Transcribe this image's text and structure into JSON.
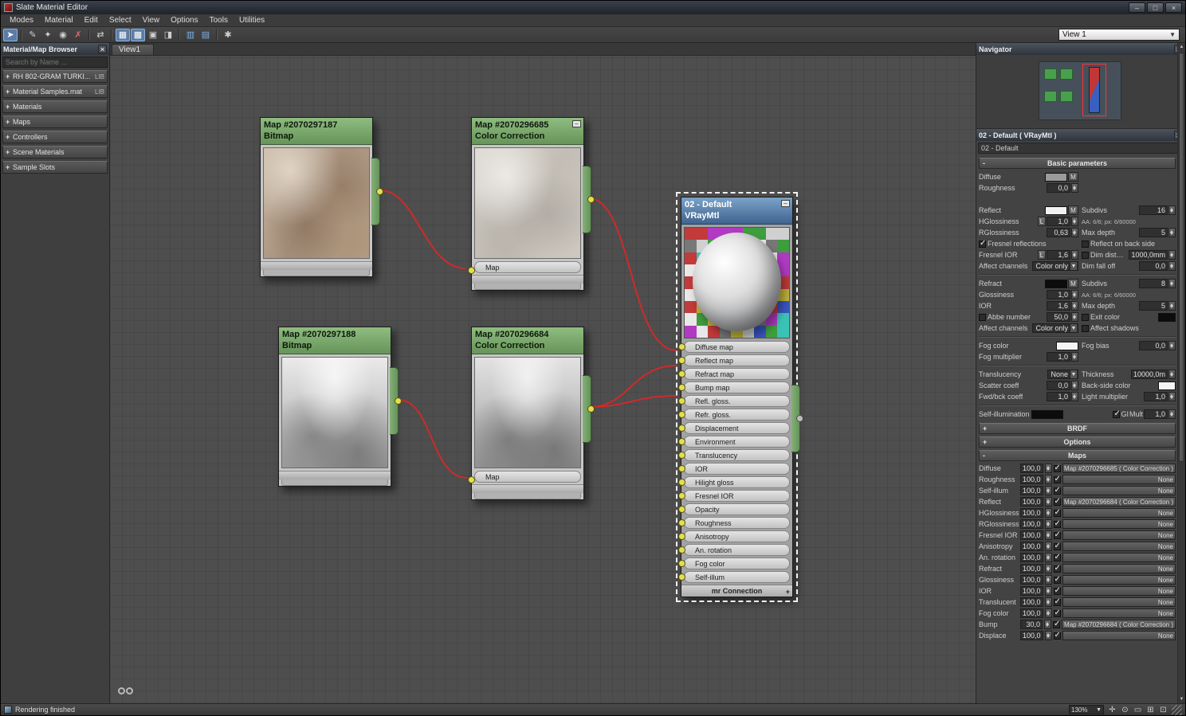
{
  "titlebar": {
    "title": "Slate Material Editor"
  },
  "window_controls": [
    {
      "name": "minimize-button",
      "glyph": "–"
    },
    {
      "name": "maximize-button",
      "glyph": "□"
    },
    {
      "name": "close-button",
      "glyph": "×"
    }
  ],
  "menubar": {
    "items": [
      "Modes",
      "Material",
      "Edit",
      "Select",
      "View",
      "Options",
      "Tools",
      "Utilities"
    ]
  },
  "toolbar": {
    "view_selector": "View 1",
    "icons": [
      {
        "name": "select-tool-icon",
        "glyph": "➤",
        "active": true
      },
      {
        "sep": true
      },
      {
        "name": "pick-material-from-object-icon",
        "glyph": "✎"
      },
      {
        "name": "put-material-to-scene-icon",
        "glyph": "✦"
      },
      {
        "name": "assign-material-to-selection-icon",
        "glyph": "◉"
      },
      {
        "name": "delete-selected-icon",
        "glyph": "✗",
        "red": true
      },
      {
        "sep": true
      },
      {
        "name": "move-children-icon",
        "glyph": "⇄"
      },
      {
        "sep": true
      },
      {
        "name": "show-grid-icon",
        "glyph": "▦",
        "active": true
      },
      {
        "name": "show-background-icon",
        "glyph": "▩",
        "active": true
      },
      {
        "name": "material-id-channel-icon",
        "glyph": "▣"
      },
      {
        "name": "render-preview-icon",
        "glyph": "◨"
      },
      {
        "sep": true
      },
      {
        "name": "layout-all-icon",
        "glyph": "▥",
        "accent": true
      },
      {
        "name": "layout-children-icon",
        "glyph": "▤",
        "accent": true
      },
      {
        "sep": true
      },
      {
        "name": "options-icon",
        "glyph": "✱"
      }
    ]
  },
  "browser": {
    "title": "Material/Map Browser",
    "search_placeholder": "Search by Name ...",
    "sections": [
      {
        "label": "RH 802-GRAM TURKI...",
        "badge": "LIB"
      },
      {
        "label": "Material Samples.mat",
        "badge": "LIB"
      },
      {
        "label": "Materials",
        "badge": ""
      },
      {
        "label": "Maps",
        "badge": ""
      },
      {
        "label": "Controllers",
        "badge": ""
      },
      {
        "label": "Scene Materials",
        "badge": ""
      },
      {
        "label": "Sample Slots",
        "badge": ""
      }
    ]
  },
  "viewtab": {
    "label": "View1"
  },
  "graph": {
    "nodes": {
      "bitmap1": {
        "title": "Map #2070297187",
        "subtitle": "Bitmap"
      },
      "cc1": {
        "title": "Map #2070296685",
        "subtitle": "Color Correction",
        "slot": "Map"
      },
      "bitmap2": {
        "title": "Map #2070297188",
        "subtitle": "Bitmap"
      },
      "cc2": {
        "title": "Map #2070296684",
        "subtitle": "Color Correction",
        "slot": "Map"
      },
      "vray": {
        "title": "02 - Default",
        "subtitle": "VRayMtl",
        "slots": [
          "Diffuse map",
          "Reflect map",
          "Refract map",
          "Bump map",
          "Refl. gloss.",
          "Refr. gloss.",
          "Displacement",
          "Environment",
          "Translucency",
          "IOR",
          "Hilight gloss",
          "Fresnel IOR",
          "Opacity",
          "Roughness",
          "Anisotropy",
          "An. rotation",
          "Fog color",
          "Self-illum"
        ],
        "footer": "mr Connection"
      }
    },
    "wire_color": "#cf2a2a",
    "preview_palette": [
      "#3f9d3f",
      "#c23a3a",
      "#3a55c2",
      "#e8e8e8",
      "#d0d0d0",
      "#b03ac2",
      "#c2b63a",
      "#3ac2b6",
      "#787878"
    ]
  },
  "navigator": {
    "title": "Navigator"
  },
  "inspector": {
    "title": "02 - Default  ( VRayMtl )",
    "name_value": "02 - Default",
    "m": "M",
    "L": "L",
    "basic": {
      "header": "Basic parameters",
      "diffuse": "Diffuse",
      "roughness": "Roughness",
      "roughness_v": "0,0",
      "reflect": "Reflect",
      "hglossiness": "HGlossiness",
      "hglossiness_v": "1,0",
      "rglossiness": "RGlossiness",
      "rglossiness_v": "0,63",
      "fresnel_reflections": "Fresnel reflections",
      "fresnel_ior": "Fresnel IOR",
      "fresnel_ior_v": "1,6",
      "affect_channels": "Affect channels",
      "affect_channels_v": "Color only",
      "subdivs": "Subdivs",
      "subdivs_v": "16",
      "aa": "AA: 6/6; px: 6/60000",
      "max_depth": "Max depth",
      "max_depth_v": "5",
      "reflect_back": "Reflect on back side",
      "dim_distance": "Dim distance",
      "dim_distance_v": "1000,0mm",
      "dim_falloff": "Dim fall off",
      "dim_falloff_v": "0,0"
    },
    "refract": {
      "refract": "Refract",
      "glossiness": "Glossiness",
      "glossiness_v": "1,0",
      "ior": "IOR",
      "ior_v": "1,6",
      "abbe": "Abbe number",
      "abbe_v": "50,0",
      "affect_channels": "Affect channels",
      "affect_channels_v": "Color only",
      "subdivs": "Subdivs",
      "subdivs_v": "8",
      "aa": "AA: 6/6; px: 6/60000",
      "max_depth": "Max depth",
      "max_depth_v": "5",
      "exit_color": "Exit color",
      "affect_shadows": "Affect shadows"
    },
    "fog": {
      "fog_color": "Fog color",
      "fog_multiplier": "Fog multiplier",
      "fog_multiplier_v": "1,0",
      "fog_bias": "Fog bias",
      "fog_bias_v": "0,0"
    },
    "translucency": {
      "translucency": "Translucency",
      "translucency_v": "None",
      "scatter": "Scatter coeff",
      "scatter_v": "0,0",
      "fwdbck": "Fwd/bck coeff",
      "fwdbck_v": "1,0",
      "thickness": "Thickness",
      "thickness_v": "10000,0m",
      "backside": "Back-side color",
      "light_mult": "Light multiplier",
      "light_mult_v": "1,0"
    },
    "selfillum": {
      "label": "Self-illumination",
      "gi": "GI",
      "mult": "Mult",
      "mult_v": "1,0"
    },
    "rollouts": {
      "brdf": "BRDF",
      "options": "Options",
      "maps": "Maps"
    },
    "maps_rows": [
      {
        "label": "Diffuse",
        "amount": "100,0",
        "map": "Map #2070296685  ( Color Correction )"
      },
      {
        "label": "Roughness",
        "amount": "100,0",
        "map": "None"
      },
      {
        "label": "Self-illum",
        "amount": "100,0",
        "map": "None"
      },
      {
        "label": "Reflect",
        "amount": "100,0",
        "map": "Map #2070296684  ( Color Correction )"
      },
      {
        "label": "HGlossiness",
        "amount": "100,0",
        "map": "None"
      },
      {
        "label": "RGlossiness",
        "amount": "100,0",
        "map": "None"
      },
      {
        "label": "Fresnel IOR",
        "amount": "100,0",
        "map": "None"
      },
      {
        "label": "Anisotropy",
        "amount": "100,0",
        "map": "None"
      },
      {
        "label": "An. rotation",
        "amount": "100,0",
        "map": "None"
      },
      {
        "label": "Refract",
        "amount": "100,0",
        "map": "None"
      },
      {
        "label": "Glossiness",
        "amount": "100,0",
        "map": "None"
      },
      {
        "label": "IOR",
        "amount": "100,0",
        "map": "None"
      },
      {
        "label": "Translucent",
        "amount": "100,0",
        "map": "None"
      },
      {
        "label": "Fog color",
        "amount": "100,0",
        "map": "None"
      },
      {
        "label": "Bump",
        "amount": "30,0",
        "map": "Map #2070296684  ( Color Correction )"
      },
      {
        "label": "Displace",
        "amount": "100,0",
        "map": "None"
      }
    ]
  },
  "statusbar": {
    "message": "Rendering finished",
    "zoom": "130%",
    "icons": [
      {
        "name": "pan-hand-icon",
        "glyph": "✛"
      },
      {
        "name": "zoom-icon",
        "glyph": "⊙"
      },
      {
        "name": "zoom-region-icon",
        "glyph": "▭"
      },
      {
        "name": "zoom-extents-icon",
        "glyph": "⊞"
      },
      {
        "name": "zoom-extents-selected-icon",
        "glyph": "⊡"
      }
    ]
  }
}
